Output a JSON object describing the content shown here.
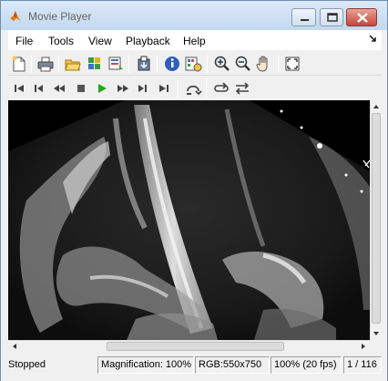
{
  "window": {
    "title": "Movie Player",
    "buttons": {
      "minimize": "minimize",
      "maximize": "maximize",
      "close": "close"
    }
  },
  "menu": {
    "items": [
      "File",
      "Tools",
      "View",
      "Playback",
      "Help"
    ]
  },
  "toolbar_top": {
    "icons": [
      "new-file-icon",
      "print-icon",
      "open-folder-icon",
      "export-icon",
      "import-icon",
      "save-frame-icon",
      "info-icon",
      "frame-rate-icon",
      "zoom-in-icon",
      "zoom-out-icon",
      "pan-hand-icon",
      "fit-to-window-icon"
    ]
  },
  "toolbar_playback": {
    "icons": [
      "go-to-first-icon",
      "step-back-icon",
      "rewind-icon",
      "stop-icon",
      "play-icon",
      "fast-forward-icon",
      "step-forward-icon",
      "go-to-last-icon",
      "jump-to-icon",
      "repeat-icon",
      "forward-backward-icon"
    ]
  },
  "status": {
    "state": "Stopped",
    "magnification": "Magnification: 100%",
    "image_type": "RGB:550x750",
    "rate": "100% (20 fps)",
    "frame": "1 / 116"
  },
  "colors": {
    "play_green": "#22a822",
    "titlebar": "#c3d8ef",
    "close_red": "#c7443a"
  }
}
